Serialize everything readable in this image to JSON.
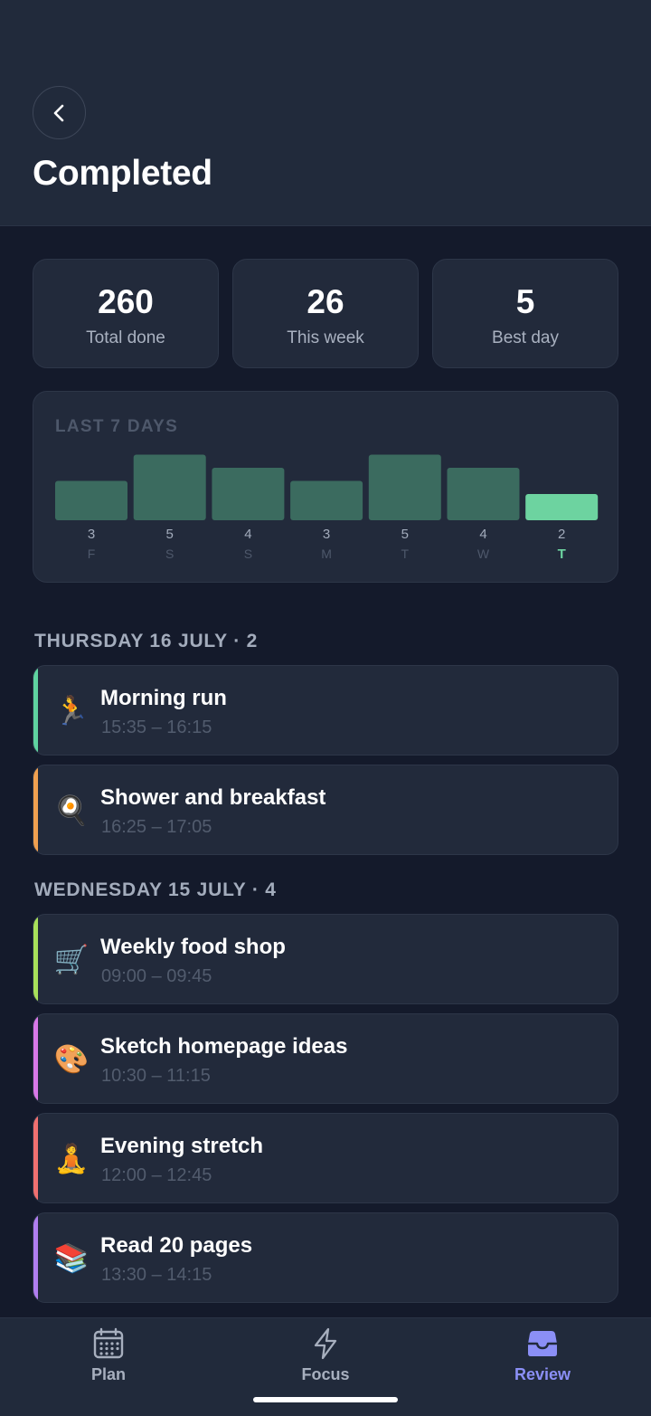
{
  "header": {
    "title": "Completed",
    "back_icon": "chevron-left-icon"
  },
  "stats": [
    {
      "value": "260",
      "label": "Total done"
    },
    {
      "value": "26",
      "label": "This week"
    },
    {
      "value": "5",
      "label": "Best day"
    }
  ],
  "chart_data": {
    "type": "bar",
    "title": "LAST 7 DAYS",
    "categories": [
      "F",
      "S",
      "S",
      "M",
      "T",
      "W",
      "T"
    ],
    "values": [
      3,
      5,
      4,
      3,
      5,
      4,
      2
    ],
    "highlight_index": 6,
    "ylim": [
      0,
      5
    ],
    "colors": {
      "bar": "#3b6b5f",
      "highlight": "#6dd3a0"
    }
  },
  "sections": [
    {
      "title": "THURSDAY 16 JULY · 2",
      "tasks": [
        {
          "icon": "🏃",
          "icon_name": "running-icon",
          "name": "Morning run",
          "time": "15:35 – 16:15",
          "color": "#5fd3a0"
        },
        {
          "icon": "🍳",
          "icon_name": "frying-pan-icon",
          "name": "Shower and breakfast",
          "time": "16:25 – 17:05",
          "color": "#f0a050"
        }
      ]
    },
    {
      "title": "WEDNESDAY 15 JULY · 4",
      "tasks": [
        {
          "icon": "🛒",
          "icon_name": "shopping-cart-icon",
          "name": "Weekly food shop",
          "time": "09:00 – 09:45",
          "color": "#a8e05a"
        },
        {
          "icon": "🎨",
          "icon_name": "palette-icon",
          "name": "Sketch homepage ideas",
          "time": "10:30 – 11:15",
          "color": "#d878e8"
        },
        {
          "icon": "🧘",
          "icon_name": "meditation-icon",
          "name": "Evening stretch",
          "time": "12:00 – 12:45",
          "color": "#f07070"
        },
        {
          "icon": "📚",
          "icon_name": "books-icon",
          "name": "Read 20 pages",
          "time": "13:30 – 14:15",
          "color": "#b07ef0"
        }
      ]
    }
  ],
  "nav": [
    {
      "label": "Plan",
      "icon": "calendar-icon"
    },
    {
      "label": "Focus",
      "icon": "lightning-icon"
    },
    {
      "label": "Review",
      "icon": "inbox-icon",
      "active": true
    }
  ],
  "colors": {
    "accent": "#8b8ff6",
    "background": "#141a2b",
    "card": "#222a3b"
  }
}
